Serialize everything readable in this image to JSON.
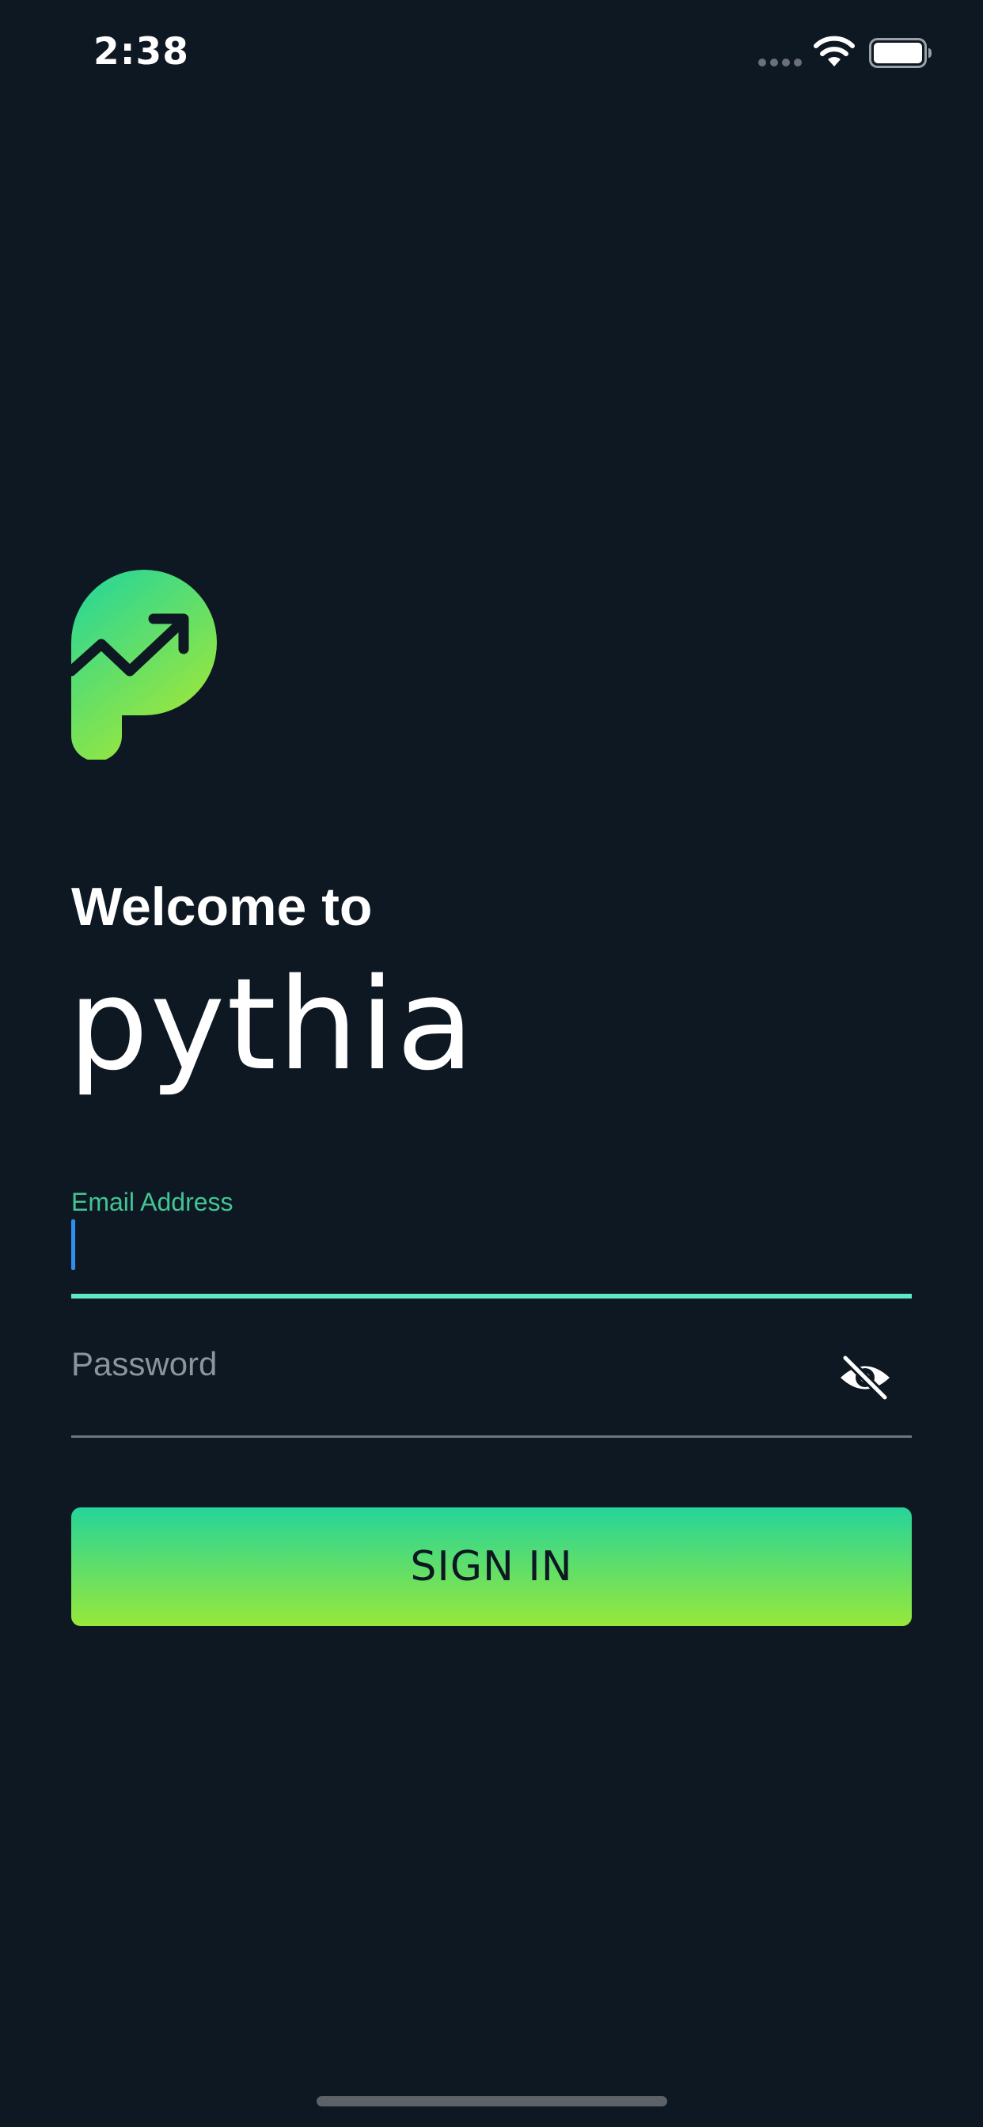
{
  "status_bar": {
    "time": "2:38",
    "signal_icon": "signal-dots-icon",
    "wifi_icon": "wifi-icon",
    "battery_icon": "battery-icon"
  },
  "logo": {
    "icon": "pythia-logo-icon",
    "colors": {
      "top": "#1fd59f",
      "bottom": "#a2e836",
      "arrow": "#0e1823"
    }
  },
  "header": {
    "welcome": "Welcome to",
    "brand": "pythia"
  },
  "form": {
    "email": {
      "label": "Email Address",
      "value": ""
    },
    "password": {
      "placeholder": "Password",
      "value": "",
      "visibility_icon": "eye-off-icon"
    },
    "signin_label": "SIGN IN"
  },
  "colors": {
    "background": "#0e1823",
    "accent": "#43c493",
    "focus_underline": "#5fe8c4",
    "caret": "#2f8ff0",
    "button_gradient_top": "#26d49a",
    "button_gradient_bottom": "#97e83a"
  }
}
